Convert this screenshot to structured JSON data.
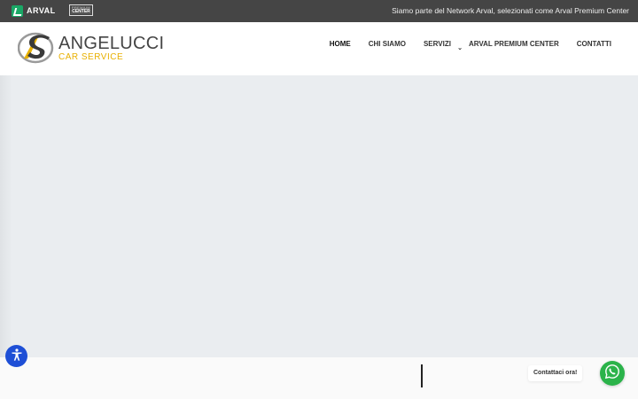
{
  "topbar": {
    "arval_label": "ARVAL",
    "premium_line1": "PREMIUM",
    "premium_line2": "CENTER",
    "message": "Siamo parte del Network Arval, selezionati come Arval Premium Center"
  },
  "brand": {
    "name": "ANGELUCCI",
    "subtitle": "CAR SERVICE",
    "accent_color": "#e8b000"
  },
  "nav": {
    "items": [
      {
        "label": "HOME",
        "active": true
      },
      {
        "label": "CHI SIAMO",
        "active": false
      },
      {
        "label": "SERVIZI",
        "active": false,
        "has_dropdown": true
      },
      {
        "label": "ARVAL PREMIUM CENTER",
        "active": false
      },
      {
        "label": "CONTATTI",
        "active": false
      }
    ]
  },
  "widgets": {
    "contact_label": "Contattaci ora!",
    "accessibility_icon": "accessibility-icon",
    "whatsapp_icon": "whatsapp-icon",
    "accessibility_color": "#1e4fd6",
    "whatsapp_color": "#2bb34a"
  }
}
